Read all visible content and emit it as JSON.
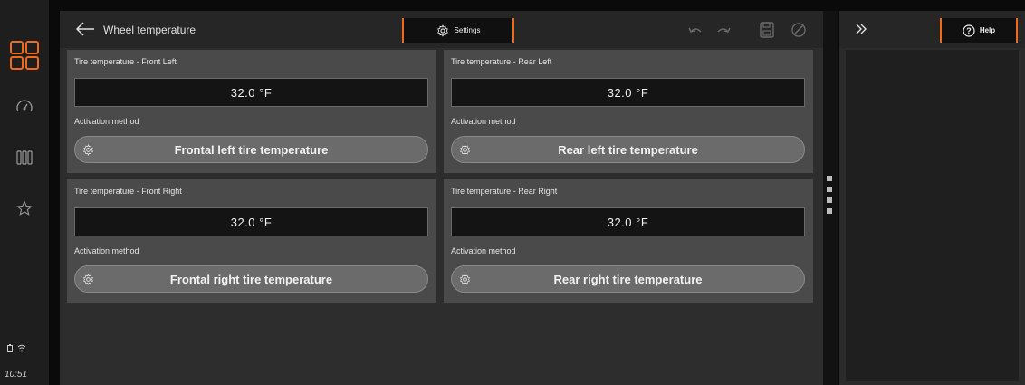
{
  "colors": {
    "accent": "#f06a1a",
    "rail": "#1e1e1e",
    "panel": "#2d2d2d",
    "card": "#4a4a4a"
  },
  "rail": {
    "icons": [
      "apps-grid-icon",
      "speedometer-icon",
      "columns-icon",
      "star-icon"
    ],
    "status_icons": [
      "battery-icon",
      "wifi-icon"
    ],
    "time": "10:51"
  },
  "header": {
    "title": "Wheel temperature",
    "settings_label": "Settings",
    "tools": [
      "undo-icon",
      "redo-icon",
      "save-icon",
      "cancel-icon"
    ]
  },
  "cards": [
    {
      "label": "Tire temperature - Front Left",
      "value": "32.0 °F",
      "method_label": "Activation method",
      "method_value": "Frontal left tire temperature"
    },
    {
      "label": "Tire temperature - Rear Left",
      "value": "32.0 °F",
      "method_label": "Activation method",
      "method_value": "Rear left tire temperature"
    },
    {
      "label": "Tire temperature - Front Right",
      "value": "32.0 °F",
      "method_label": "Activation method",
      "method_value": "Frontal right tire temperature"
    },
    {
      "label": "Tire temperature - Rear Right",
      "value": "32.0 °F",
      "method_label": "Activation method",
      "method_value": "Rear right tire temperature"
    }
  ],
  "help": {
    "label": "Help"
  }
}
